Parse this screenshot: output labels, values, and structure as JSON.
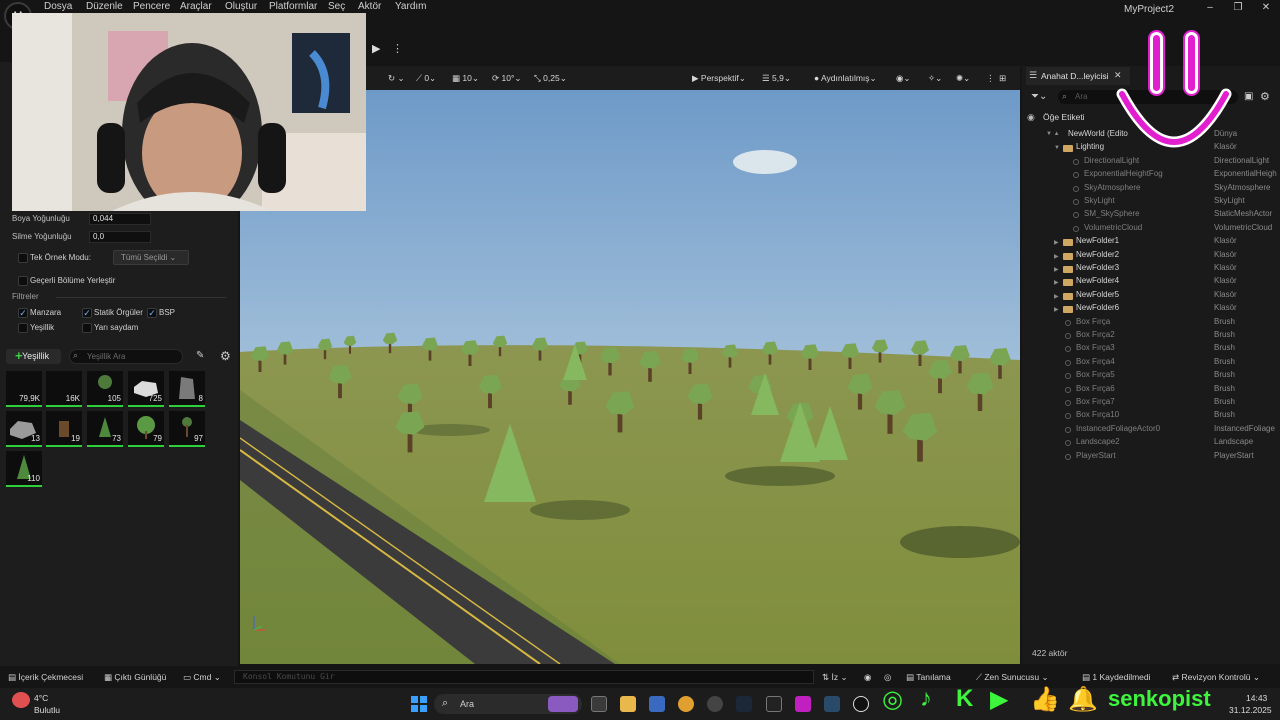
{
  "menu": {
    "items": [
      "Dosya",
      "Düzenle",
      "Pencere",
      "Araçlar",
      "Oluştur",
      "Platformlar",
      "Seç",
      "Aktör",
      "Yardım"
    ],
    "project_title": "MyProject2"
  },
  "left_panel": {
    "paint_density_label": "Boya Yoğunluğu",
    "paint_density_value": "0,044",
    "erase_density_label": "Silme Yoğunluğu",
    "erase_density_value": "0,0",
    "single_instance_label": "Tek Örnek Modu:",
    "single_instance_value": "Tümü Seçildi",
    "place_current_level_label": "Geçerli Bölüme Yerleştir",
    "filters_header": "Filtreler",
    "filters": {
      "landscape": "Manzara",
      "static_mesh": "Statik Örgüler",
      "bsp": "BSP",
      "foliage": "Yeşillik",
      "translucent": "Yarı saydam"
    },
    "add_foliage_label": "Yeşillik",
    "search_placeholder": "Yeşillik Ara",
    "tiles": [
      "79,9K",
      "16K",
      "105",
      "725",
      "8",
      "13",
      "19",
      "73",
      "79",
      "97",
      "110"
    ]
  },
  "viewport": {
    "snap_rotation": "0",
    "grid_snap": "10",
    "rot_snap": "10°",
    "scale_snap": "0,25",
    "view_mode": "Perspektif",
    "camera_speed": "5,9",
    "lighting": "Aydınlatılmış"
  },
  "outliner": {
    "tab_title": "Anahat D...leyicisi",
    "search_placeholder": "Ara",
    "column_label": "Öğe Etiketi",
    "rows": [
      {
        "name": "NewWorld (Edito",
        "type": "Dünya"
      },
      {
        "name": "Lighting",
        "type": "Klasör"
      },
      {
        "name": "DirectionalLight",
        "type": "DirectionalLight"
      },
      {
        "name": "ExponentialHeightFog",
        "type": "ExponentialHeigh"
      },
      {
        "name": "SkyAtmosphere",
        "type": "SkyAtmosphere"
      },
      {
        "name": "SkyLight",
        "type": "SkyLight"
      },
      {
        "name": "SM_SkySphere",
        "type": "StaticMeshActor"
      },
      {
        "name": "VolumetricCloud",
        "type": "VolumetricCloud"
      },
      {
        "name": "NewFolder1",
        "type": "Klasör"
      },
      {
        "name": "NewFolder2",
        "type": "Klasör"
      },
      {
        "name": "NewFolder3",
        "type": "Klasör"
      },
      {
        "name": "NewFolder4",
        "type": "Klasör"
      },
      {
        "name": "NewFolder5",
        "type": "Klasör"
      },
      {
        "name": "NewFolder6",
        "type": "Klasör"
      },
      {
        "name": "Box Fırça",
        "type": "Brush"
      },
      {
        "name": "Box Fırça2",
        "type": "Brush"
      },
      {
        "name": "Box Fırça3",
        "type": "Brush"
      },
      {
        "name": "Box Fırça4",
        "type": "Brush"
      },
      {
        "name": "Box Fırça5",
        "type": "Brush"
      },
      {
        "name": "Box Fırça6",
        "type": "Brush"
      },
      {
        "name": "Box Fırça7",
        "type": "Brush"
      },
      {
        "name": "Box Fırça10",
        "type": "Brush"
      },
      {
        "name": "InstancedFoliageActor0",
        "type": "InstancedFoliage"
      },
      {
        "name": "Landscape2",
        "type": "Landscape"
      },
      {
        "name": "PlayerStart",
        "type": "PlayerStart"
      }
    ],
    "actor_count": "422 aktör"
  },
  "statusbar": {
    "content_drawer": "İçerik Çekmecesi",
    "output_log": "Çıktı Günlüğü",
    "cmd": "Cmd",
    "console_placeholder": "Konsol Komutunu Gir",
    "trace": "İz",
    "derived_data": "Tanılama",
    "zen_server": "Zen Sunucusu",
    "saved": "1 Kaydedilmedi",
    "revision_control": "Revizyon Kontrolü"
  },
  "taskbar": {
    "weather_temp": "4°C",
    "weather_desc": "Bulutlu",
    "search_label": "Ara",
    "time": "14:43",
    "date": "31.12.2025",
    "channel_name": "senkopist"
  },
  "colors": {
    "accent_green": "#2dd03a",
    "folder": "#d0a663",
    "social_green": "#3cf53c",
    "smiley_pink": "#e11fcf"
  }
}
